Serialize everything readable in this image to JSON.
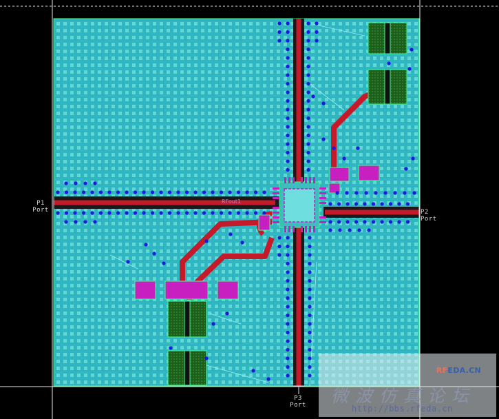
{
  "ports": {
    "p1": {
      "name": "P1",
      "type": "Port"
    },
    "p2": {
      "name": "P2",
      "type": "Port"
    },
    "p3": {
      "name": "P3",
      "type": "Port"
    }
  },
  "chip_label": "RFout1",
  "watermark": {
    "logo_rf": "RF",
    "logo_rest": "EDA.CN",
    "title": "微波仿真论坛",
    "url": "http://bbs.rfeda.cn"
  },
  "colors": {
    "background": "#000000",
    "substrate": "#35c4cc",
    "trace": "#c41a2a",
    "pad": "#c81fc0",
    "capacitor": "#1c6e22",
    "via": "#1c18e0",
    "outline": "#3cff8a"
  }
}
